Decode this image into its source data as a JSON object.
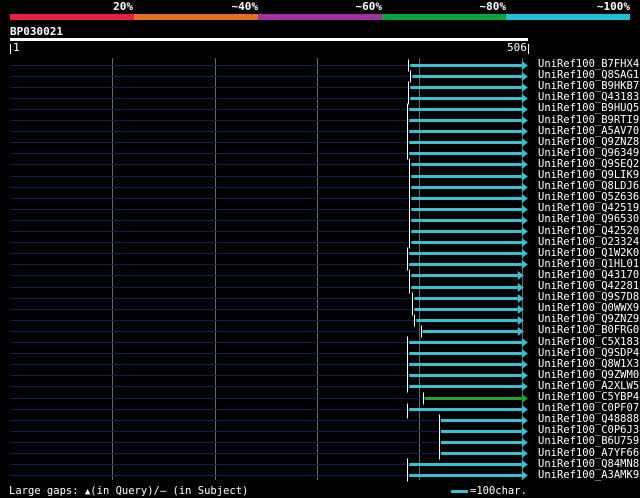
{
  "legend": {
    "bands": [
      {
        "label": "20%",
        "color": "#e5213e"
      },
      {
        "label": "~40%",
        "color": "#e2701f"
      },
      {
        "label": "~60%",
        "color": "#a0339d"
      },
      {
        "label": "~80%",
        "color": "#0fa33e"
      },
      {
        "label": "~100%",
        "color": "#1cc2cd"
      }
    ]
  },
  "query": {
    "id": "BP030021",
    "start": "1",
    "end": "506",
    "length": 506
  },
  "colors": {
    "bar_high": "#35c3d4",
    "bar_mid": "#1ea52c",
    "unaligned": "#0c1f52",
    "gap_marker": "#ffffff",
    "grid": "#6a6a6a"
  },
  "hits": [
    {
      "name": "UniRef100_B7FHX4",
      "q_start": 391,
      "q_end": 500,
      "identity": "high",
      "gap": "none"
    },
    {
      "name": "UniRef100_Q8SAG1",
      "q_start": 393,
      "q_end": 500,
      "identity": "high",
      "gap": "none"
    },
    {
      "name": "UniRef100_B9HKB7",
      "q_start": 391,
      "q_end": 500,
      "identity": "high",
      "gap": "none"
    },
    {
      "name": "UniRef100_Q43183",
      "q_start": 391,
      "q_end": 500,
      "identity": "high",
      "gap": "none"
    },
    {
      "name": "UniRef100_B9HUQ5",
      "q_start": 390,
      "q_end": 500,
      "identity": "high",
      "gap": "none"
    },
    {
      "name": "UniRef100_B9RTI9",
      "q_start": 390,
      "q_end": 500,
      "identity": "high",
      "gap": "none"
    },
    {
      "name": "UniRef100_A5AV70",
      "q_start": 390,
      "q_end": 500,
      "identity": "high",
      "gap": "none"
    },
    {
      "name": "UniRef100_Q9ZNZ8",
      "q_start": 390,
      "q_end": 500,
      "identity": "high",
      "gap": "none"
    },
    {
      "name": "UniRef100_Q96349",
      "q_start": 390,
      "q_end": 500,
      "identity": "high",
      "gap": "none"
    },
    {
      "name": "UniRef100_Q9SEQ2",
      "q_start": 392,
      "q_end": 500,
      "identity": "high",
      "gap": "none"
    },
    {
      "name": "UniRef100_Q9LIK9",
      "q_start": 392,
      "q_end": 500,
      "identity": "high",
      "gap": "none"
    },
    {
      "name": "UniRef100_Q8LDJ6",
      "q_start": 392,
      "q_end": 500,
      "identity": "high",
      "gap": "none"
    },
    {
      "name": "UniRef100_Q5Z636",
      "q_start": 392,
      "q_end": 500,
      "identity": "high",
      "gap": "none"
    },
    {
      "name": "UniRef100_Q42519",
      "q_start": 392,
      "q_end": 500,
      "identity": "high",
      "gap": "none"
    },
    {
      "name": "UniRef100_Q96530",
      "q_start": 392,
      "q_end": 500,
      "identity": "high",
      "gap": "none"
    },
    {
      "name": "UniRef100_Q42520",
      "q_start": 392,
      "q_end": 500,
      "identity": "high",
      "gap": "none"
    },
    {
      "name": "UniRef100_O23324",
      "q_start": 392,
      "q_end": 500,
      "identity": "high",
      "gap": "none"
    },
    {
      "name": "UniRef100_Q1W2K0",
      "q_start": 390,
      "q_end": 500,
      "identity": "high",
      "gap": "none"
    },
    {
      "name": "UniRef100_Q1HL01",
      "q_start": 390,
      "q_end": 500,
      "identity": "high",
      "gap": "none"
    },
    {
      "name": "UniRef100_Q43170",
      "q_start": 392,
      "q_end": 496,
      "identity": "high",
      "gap": "none"
    },
    {
      "name": "UniRef100_Q42281",
      "q_start": 392,
      "q_end": 496,
      "identity": "high",
      "gap": "none"
    },
    {
      "name": "UniRef100_Q9S7D8",
      "q_start": 395,
      "q_end": 496,
      "identity": "high",
      "gap": "none"
    },
    {
      "name": "UniRef100_Q0WWX9",
      "q_start": 395,
      "q_end": 496,
      "identity": "high",
      "gap": "none"
    },
    {
      "name": "UniRef100_Q9ZNZ9",
      "q_start": 397,
      "q_end": 496,
      "identity": "high",
      "gap": "none"
    },
    {
      "name": "UniRef100_B0FRG0",
      "q_start": 403,
      "q_end": 496,
      "identity": "high",
      "gap": "none"
    },
    {
      "name": "UniRef100_C5X183",
      "q_start": 390,
      "q_end": 500,
      "identity": "high",
      "gap": "none"
    },
    {
      "name": "UniRef100_Q9SDP4",
      "q_start": 390,
      "q_end": 500,
      "identity": "high",
      "gap": "none"
    },
    {
      "name": "UniRef100_Q8W1X3",
      "q_start": 390,
      "q_end": 500,
      "identity": "high",
      "gap": "none"
    },
    {
      "name": "UniRef100_Q9ZWM0",
      "q_start": 390,
      "q_end": 500,
      "identity": "high",
      "gap": "none"
    },
    {
      "name": "UniRef100_A2XLW5",
      "q_start": 390,
      "q_end": 500,
      "identity": "high",
      "gap": "none"
    },
    {
      "name": "UniRef100_C5YBP4",
      "q_start": 405,
      "q_end": 500,
      "identity": "mid",
      "gap": "none"
    },
    {
      "name": "UniRef100_C0PF07",
      "q_start": 390,
      "q_end": 500,
      "identity": "high",
      "gap": "subject"
    },
    {
      "name": "UniRef100_Q48888",
      "q_start": 421,
      "q_end": 500,
      "identity": "high",
      "gap": "query"
    },
    {
      "name": "UniRef100_C0P6J3",
      "q_start": 421,
      "q_end": 500,
      "identity": "high",
      "gap": "query"
    },
    {
      "name": "UniRef100_B6U759",
      "q_start": 421,
      "q_end": 500,
      "identity": "high",
      "gap": "query"
    },
    {
      "name": "UniRef100_A7YF66",
      "q_start": 421,
      "q_end": 500,
      "identity": "high",
      "gap": "query"
    },
    {
      "name": "UniRef100_Q84MN8",
      "q_start": 390,
      "q_end": 500,
      "identity": "high",
      "gap": "query"
    },
    {
      "name": "UniRef100_A3AMK9",
      "q_start": 390,
      "q_end": 500,
      "identity": "high",
      "gap": "query"
    }
  ],
  "footer": {
    "large_gaps_label": "Large gaps:",
    "query_marker": "▲",
    "query_text": "(in Query)/",
    "subject_marker": "―",
    "subject_text": " (in Subject)",
    "scale_text": "=100char."
  }
}
